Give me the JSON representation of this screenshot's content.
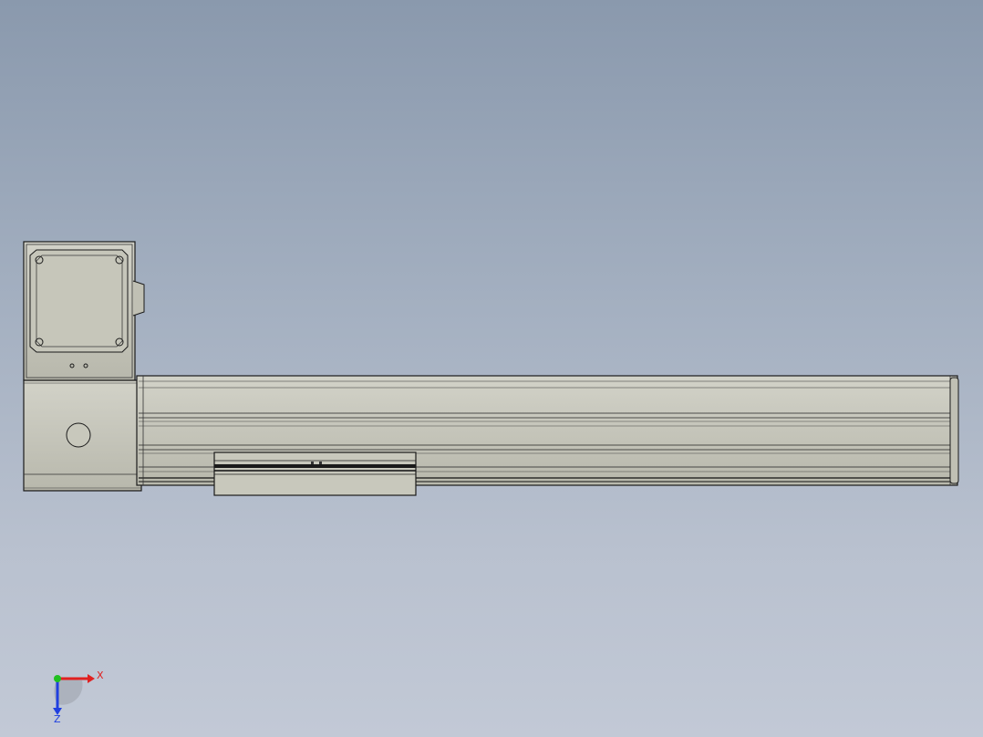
{
  "model": {
    "name": "",
    "parts": [
      "motor-flange",
      "motor-housing",
      "drive-end-block",
      "rail-profile",
      "carriage"
    ]
  },
  "colors": {
    "background_top": "#8a99ad",
    "background_bottom": "#c2c9d6",
    "part_fill": "#c4c4b8",
    "part_edge": "#1a1a1a",
    "axis_x": "#e02020",
    "axis_y": "#20c020",
    "axis_z": "#2040e0"
  },
  "triad": {
    "x_label": "X",
    "z_label": "Z"
  }
}
